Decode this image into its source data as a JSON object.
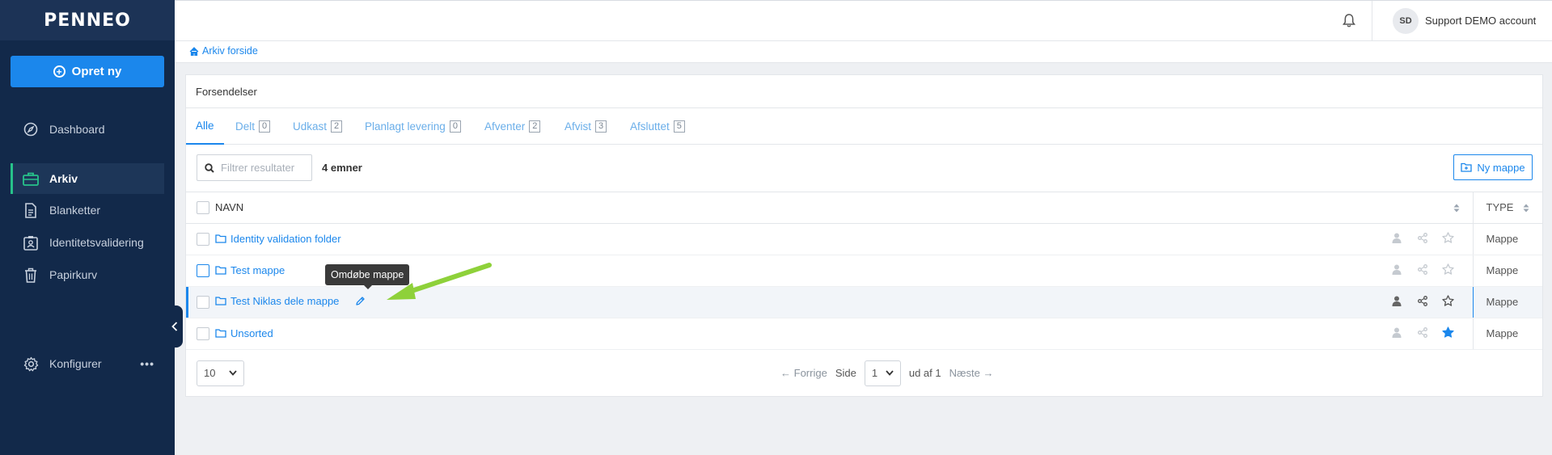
{
  "brand": {
    "logo": "PENNEO"
  },
  "sidebar": {
    "create_label": "Opret ny",
    "items": [
      {
        "label": "Dashboard",
        "icon": "compass-icon"
      },
      {
        "label": "Arkiv",
        "icon": "briefcase-icon",
        "active": true
      },
      {
        "label": "Blanketter",
        "icon": "document-icon"
      },
      {
        "label": "Identitetsvalidering",
        "icon": "id-card-icon"
      },
      {
        "label": "Papirkurv",
        "icon": "trash-icon"
      }
    ],
    "configure_label": "Konfigurer",
    "configure_more": "•••"
  },
  "header": {
    "initials": "SD",
    "account_name": "Support DEMO account"
  },
  "breadcrumb": {
    "label": "Arkiv forside"
  },
  "card": {
    "title": "Forsendelser",
    "tabs": [
      {
        "label": "Alle",
        "count": ""
      },
      {
        "label": "Delt",
        "count": "0"
      },
      {
        "label": "Udkast",
        "count": "2"
      },
      {
        "label": "Planlagt levering",
        "count": "0"
      },
      {
        "label": "Afventer",
        "count": "2"
      },
      {
        "label": "Afvist",
        "count": "3"
      },
      {
        "label": "Afsluttet",
        "count": "5"
      }
    ],
    "filter_placeholder": "Filtrer resultater",
    "item_count": "4 emner",
    "new_folder_label": "Ny mappe",
    "columns": {
      "name": "NAVN",
      "type": "TYPE"
    },
    "rows": [
      {
        "name": "Identity validation folder",
        "type": "Mappe",
        "starred": false
      },
      {
        "name": "Test mappe",
        "type": "Mappe",
        "starred": false
      },
      {
        "name": "Test Niklas dele mappe",
        "type": "Mappe",
        "starred": false,
        "hovered": true
      },
      {
        "name": "Unsorted",
        "type": "Mappe",
        "starred": true
      }
    ],
    "pager": {
      "page_size": "10",
      "prev": "Forrige",
      "page_label": "Side",
      "page": "1",
      "of_label": "ud af 1",
      "next": "Næste"
    }
  },
  "tooltip": {
    "text": "Omdøbe mappe"
  },
  "colors": {
    "accent": "#1b87ec",
    "sidebar": "#12294a",
    "active_marker": "#27c28a",
    "annotation": "#8ed13a"
  }
}
